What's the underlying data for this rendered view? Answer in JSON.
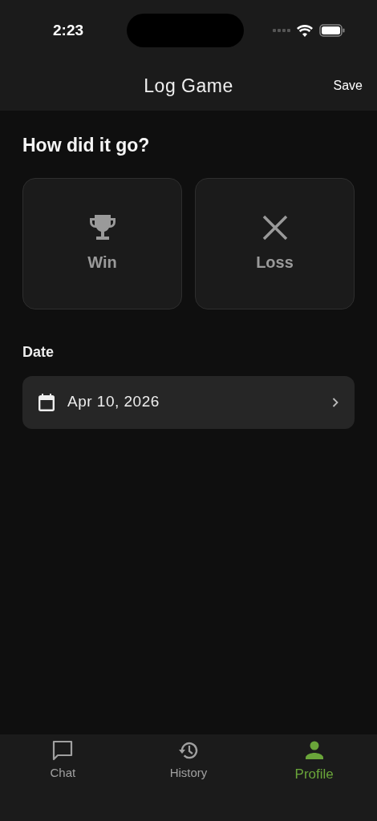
{
  "status_bar": {
    "time": "2:23"
  },
  "header": {
    "title": "Log Game",
    "action": "Save"
  },
  "question": "How did it go?",
  "outcomes": [
    {
      "kind": "trophy",
      "label": "Win",
      "selected": false
    },
    {
      "kind": "cross",
      "label": "Loss",
      "selected": false
    }
  ],
  "date": {
    "label": "Date",
    "value": "Apr 10, 2026"
  },
  "tabs": [
    {
      "kind": "chat",
      "label": "Chat",
      "selected": false
    },
    {
      "kind": "history",
      "label": "History",
      "selected": false
    },
    {
      "kind": "person",
      "label": "Profile",
      "selected": true
    }
  ]
}
